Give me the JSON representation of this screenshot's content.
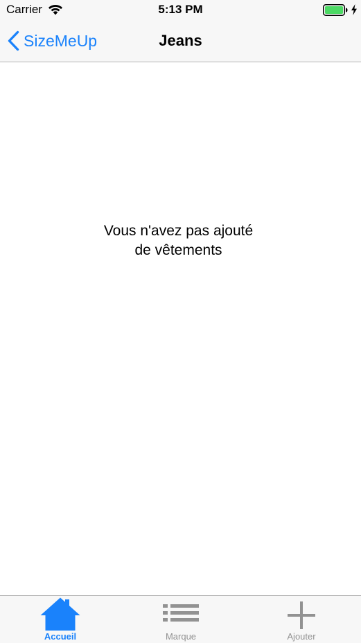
{
  "status_bar": {
    "carrier": "Carrier",
    "time": "5:13 PM",
    "wifi_icon": "wifi-icon",
    "battery_icon": "battery-icon",
    "charging_icon": "charging-bolt-icon",
    "battery_color": "#4cd964"
  },
  "nav_bar": {
    "back_label": "SizeMeUp",
    "back_icon": "chevron-left-icon",
    "title": "Jeans",
    "tint_color": "#1a82fb"
  },
  "content": {
    "empty_line_1": "Vous n'avez pas ajouté",
    "empty_line_2": "de vêtements"
  },
  "tab_bar": {
    "active_color": "#1a82fb",
    "inactive_color": "#929292",
    "tabs": [
      {
        "label": "Accueil",
        "icon": "home-icon",
        "active": true
      },
      {
        "label": "Marque",
        "icon": "list-icon",
        "active": false
      },
      {
        "label": "Ajouter",
        "icon": "plus-icon",
        "active": false
      }
    ]
  }
}
